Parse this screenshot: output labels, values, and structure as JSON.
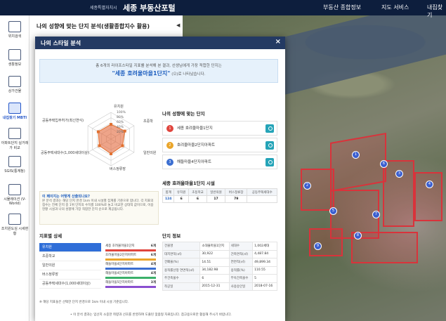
{
  "topbar": {
    "logo": "세종특별자치시",
    "title": "세종 부동산포털",
    "nav": [
      "부동산 종합정보",
      "지도 서비스",
      "내집찾기"
    ]
  },
  "sidebar": {
    "items": [
      {
        "label": "위치검색",
        "icon": "search-location-icon"
      },
      {
        "label": "생활정보",
        "icon": "info-icon"
      },
      {
        "label": "상가건물",
        "icon": "building-icon"
      },
      {
        "label": "내집찾기 MBTI",
        "icon": "building-search-icon",
        "active": true
      },
      {
        "label": "아파트단지 실거래가 비교",
        "icon": "apartment-icon"
      },
      {
        "label": "SGIS(통계청)",
        "icon": "stats-icon"
      },
      {
        "label": "시뮬레이션 (V-World)",
        "icon": "chart-icon"
      },
      {
        "label": "조치원도심 시세현황",
        "icon": "airplane-icon"
      }
    ]
  },
  "behind_panel": {
    "title": "나의 성향에 맞는 단지 분석(생활종합지수 활용)"
  },
  "modal": {
    "title": "나의 스타일 분석",
    "close": "×",
    "result_line1": "총 6개의 라이프스타일 지표를 분석해 본 결과, 선생님에게 가장 적합한 단지는",
    "result_name": "\"세종 호려울마을1단지\"",
    "result_suffix": "(으)로 나타났습니다.",
    "radar": {
      "labels": [
        "유치원",
        "초중학",
        "일반의원",
        "버스정류장",
        "공동주택세대수(1,000세대이상)",
        "공동주택입주허가(최신연식)"
      ],
      "pct": [
        "100%",
        "80%",
        "60%",
        "40%",
        "20%"
      ],
      "values": [
        0.55,
        0.6,
        0.5,
        0.55,
        0.5,
        0.55
      ]
    },
    "match_title": "나의 성향에 맞는 단지",
    "matches": [
      {
        "rank": "1",
        "name": "세종 호려울마을1단지",
        "color": "#e0453d"
      },
      {
        "rank": "2",
        "name": "호려울마을2단지아파트",
        "color": "#eaa52a"
      },
      {
        "rank": "3",
        "name": "해들마을4단지아파트",
        "color": "#3b6ed1"
      }
    ],
    "fac_title": "세종 호려울마을1단지 시설",
    "fac_headers": [
      "합계",
      "유치원",
      "초등학교",
      "일반의원",
      "버스정류장",
      "공동주택세대수"
    ],
    "fac_values": [
      "124",
      "6",
      "6",
      "17",
      "79",
      ""
    ],
    "info_q": "이 페이지는 어떻게 산출되나요?",
    "info_text": "본 분석 결과는 해당 단지 반경 1km 이내 시설별 집계를 기준으로 합니다. 각 지표의 점수는 전체 단지 중 1위 단지의 수치를 100%로 놓고 비교한 상대적 값이므로, 이용 현황 시설과 나의 성향에 가장 적합한 단지 순으로 제공됩니다.",
    "ind_title": "지표별 상세",
    "indicators": [
      "유치원",
      "초중학교",
      "일반의원",
      "버스정류장",
      "공동주택세대수(1,000세대이상)"
    ],
    "bars": [
      {
        "name": "세종 호려울마을1단지",
        "count": "6개",
        "color": "#e0453d"
      },
      {
        "name": "호려울마을2단지아파트",
        "count": "6개",
        "color": "#eaa52a"
      },
      {
        "name": "해들마을4단지아파트",
        "count": "4개",
        "color": "#3b6ed1"
      },
      {
        "name": "해들마을4단지아파트",
        "count": "4개",
        "color": "#3bb06a"
      },
      {
        "name": "해들마을5단지아파트",
        "count": "3개",
        "color": "#8a4fd0"
      }
    ],
    "detail_title": "단지 정보",
    "details": [
      [
        "건물명",
        "소대율마을1단지",
        "세대수",
        "1,002세대"
      ],
      [
        "대지면적(㎡)",
        "30,922",
        "건축면적(㎡)",
        "4,487.84"
      ],
      [
        "건폐율(%)",
        "14.51",
        "연면적(㎡)",
        "49,899.34"
      ],
      [
        "용적률산정 연면적(㎡)",
        "34,182.98",
        "용적률(%)",
        "110.55"
      ],
      [
        "주건축물수",
        "6",
        "부속건축물수",
        "5"
      ],
      [
        "착공일",
        "2015-12-31",
        "사용승인일",
        "2018-07-16"
      ]
    ],
    "note1": "※ 해당 지표들은 선택한 단지 반경으로 1km 이내 시설 기준입니다.",
    "note2": "• 이 분석 결과는 입선지 소중한 취향과 선호를 반영하여 도출된 맞춤형 자료입니다. 참고용으로만 활용해 주시기 바랍니다."
  },
  "map": {
    "pins": [
      "1",
      "2",
      "3",
      "4",
      "5",
      "6",
      "7",
      "8",
      "9"
    ]
  }
}
